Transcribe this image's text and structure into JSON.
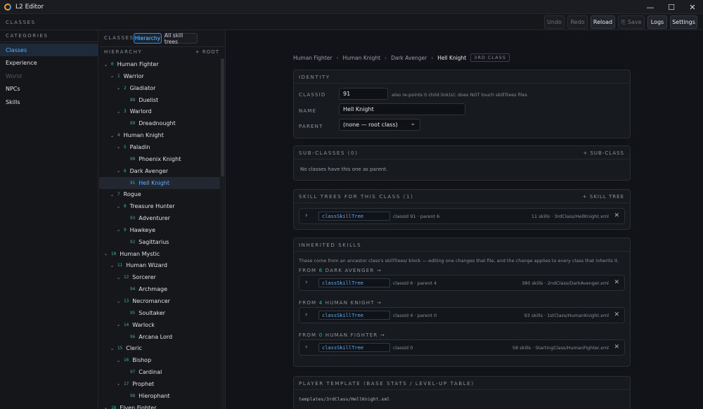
{
  "window": {
    "title": "L2 Editor",
    "minimize": "—",
    "maximize": "☐",
    "close": "✕"
  },
  "header": {
    "section": "CLASSES",
    "undo": "Undo",
    "redo": "Redo",
    "reload": "Reload",
    "save": "Save",
    "logs": "Logs",
    "settings": "Settings",
    "save_icon": "⎘"
  },
  "sidebar": {
    "heading": "CATEGORIES",
    "items": [
      {
        "label": "Classes",
        "state": "active"
      },
      {
        "label": "Experience",
        "state": "normal"
      },
      {
        "label": "World",
        "state": "disabled"
      },
      {
        "label": "NPCs",
        "state": "normal"
      },
      {
        "label": "Skills",
        "state": "normal"
      }
    ]
  },
  "classes_panel": {
    "label": "CLASSES",
    "pill_hierarchy": "Hierarchy",
    "pill_all": "All skill trees",
    "hierarchy_label": "HIERARCHY",
    "add_root": "+ ROOT"
  },
  "tree": [
    {
      "id": "0",
      "name": "Human Fighter",
      "depth": 0,
      "expand": true
    },
    {
      "id": "1",
      "name": "Warrior",
      "depth": 1,
      "expand": true
    },
    {
      "id": "2",
      "name": "Gladiator",
      "depth": 2,
      "expand": true
    },
    {
      "id": "88",
      "name": "Duelist",
      "depth": 3,
      "expand": false
    },
    {
      "id": "3",
      "name": "Warlord",
      "depth": 2,
      "expand": true
    },
    {
      "id": "89",
      "name": "Dreadnought",
      "depth": 3,
      "expand": false
    },
    {
      "id": "4",
      "name": "Human Knight",
      "depth": 1,
      "expand": true
    },
    {
      "id": "5",
      "name": "Paladin",
      "depth": 2,
      "expand": true
    },
    {
      "id": "90",
      "name": "Phoenix Knight",
      "depth": 3,
      "expand": false
    },
    {
      "id": "6",
      "name": "Dark Avenger",
      "depth": 2,
      "expand": true
    },
    {
      "id": "91",
      "name": "Hell Knight",
      "depth": 3,
      "expand": false,
      "selected": true
    },
    {
      "id": "7",
      "name": "Rogue",
      "depth": 1,
      "expand": true
    },
    {
      "id": "8",
      "name": "Treasure Hunter",
      "depth": 2,
      "expand": true
    },
    {
      "id": "93",
      "name": "Adventurer",
      "depth": 3,
      "expand": false
    },
    {
      "id": "9",
      "name": "Hawkeye",
      "depth": 2,
      "expand": true
    },
    {
      "id": "92",
      "name": "Sagittarius",
      "depth": 3,
      "expand": false
    },
    {
      "id": "10",
      "name": "Human Mystic",
      "depth": 0,
      "expand": true
    },
    {
      "id": "11",
      "name": "Human Wizard",
      "depth": 1,
      "expand": true
    },
    {
      "id": "12",
      "name": "Sorcerer",
      "depth": 2,
      "expand": true
    },
    {
      "id": "94",
      "name": "Archmage",
      "depth": 3,
      "expand": false
    },
    {
      "id": "13",
      "name": "Necromancer",
      "depth": 2,
      "expand": true
    },
    {
      "id": "95",
      "name": "Soultaker",
      "depth": 3,
      "expand": false
    },
    {
      "id": "14",
      "name": "Warlock",
      "depth": 2,
      "expand": true
    },
    {
      "id": "96",
      "name": "Arcana Lord",
      "depth": 3,
      "expand": false
    },
    {
      "id": "15",
      "name": "Cleric",
      "depth": 1,
      "expand": true
    },
    {
      "id": "16",
      "name": "Bishop",
      "depth": 2,
      "expand": true
    },
    {
      "id": "97",
      "name": "Cardinal",
      "depth": 3,
      "expand": false
    },
    {
      "id": "17",
      "name": "Prophet",
      "depth": 2,
      "expand": true
    },
    {
      "id": "98",
      "name": "Hierophant",
      "depth": 3,
      "expand": false
    },
    {
      "id": "18",
      "name": "Elven Fighter",
      "depth": 0,
      "expand": true
    }
  ],
  "breadcrumb": {
    "items": [
      "Human Fighter",
      "Human Knight",
      "Dark Avenger"
    ],
    "current": "Hell Knight",
    "tag": "3RD CLASS"
  },
  "identity": {
    "title": "IDENTITY",
    "classid_label": "CLASSID",
    "classid_value": "91",
    "classid_note": "also re-points 0 child link(s); does NOT touch skillTrees files",
    "name_label": "NAME",
    "name_value": "Hell Knight",
    "parent_label": "PARENT",
    "parent_value": "(none — root class)"
  },
  "subclasses": {
    "title": "SUB-CLASSES (0)",
    "add": "+ SUB-CLASS",
    "empty": "No classes have this one as parent."
  },
  "skill_trees": {
    "title": "SKILL TREES FOR THIS CLASS (1)",
    "add": "+ SKILL TREE",
    "rows": [
      {
        "name": "classSkillTree",
        "info": "classId 91 · parent 6",
        "file": "11 skills · 3rdClass/HellKnight.xml"
      }
    ]
  },
  "inherited": {
    "title": "INHERITED SKILLS",
    "desc": "These come from an ancestor class's skillTrees/ block — editing one changes that file, and the change applies to every class that inherits it.",
    "from_word": "FROM",
    "arrow": "→",
    "groups": [
      {
        "from_id": "6",
        "from_name": "DARK AVENGER",
        "name": "classSkillTree",
        "info": "classId 6 · parent 4",
        "file": "380 skills · 2ndClass/DarkAvenger.xml"
      },
      {
        "from_id": "4",
        "from_name": "HUMAN KNIGHT",
        "name": "classSkillTree",
        "info": "classId 4 · parent 0",
        "file": "93 skills · 1stClass/HumanKnight.xml"
      },
      {
        "from_id": "0",
        "from_name": "HUMAN FIGHTER",
        "name": "classSkillTree",
        "info": "classId 0",
        "file": "58 skills · StartingClass/HumanFighter.xml"
      }
    ]
  },
  "player_template": {
    "title": "PLAYER TEMPLATE (BASE STATS / LEVEL-UP TABLE)",
    "path": "templates/3rdClass/HellKnight.xml"
  },
  "icons": {
    "chevron_down": "⌄",
    "chevron_right": "›",
    "close": "✕",
    "select_arrow": "⌄"
  },
  "colors": {
    "accent": "#5ab0ff",
    "id_teal": "#37b7a0",
    "background": "#111318"
  }
}
